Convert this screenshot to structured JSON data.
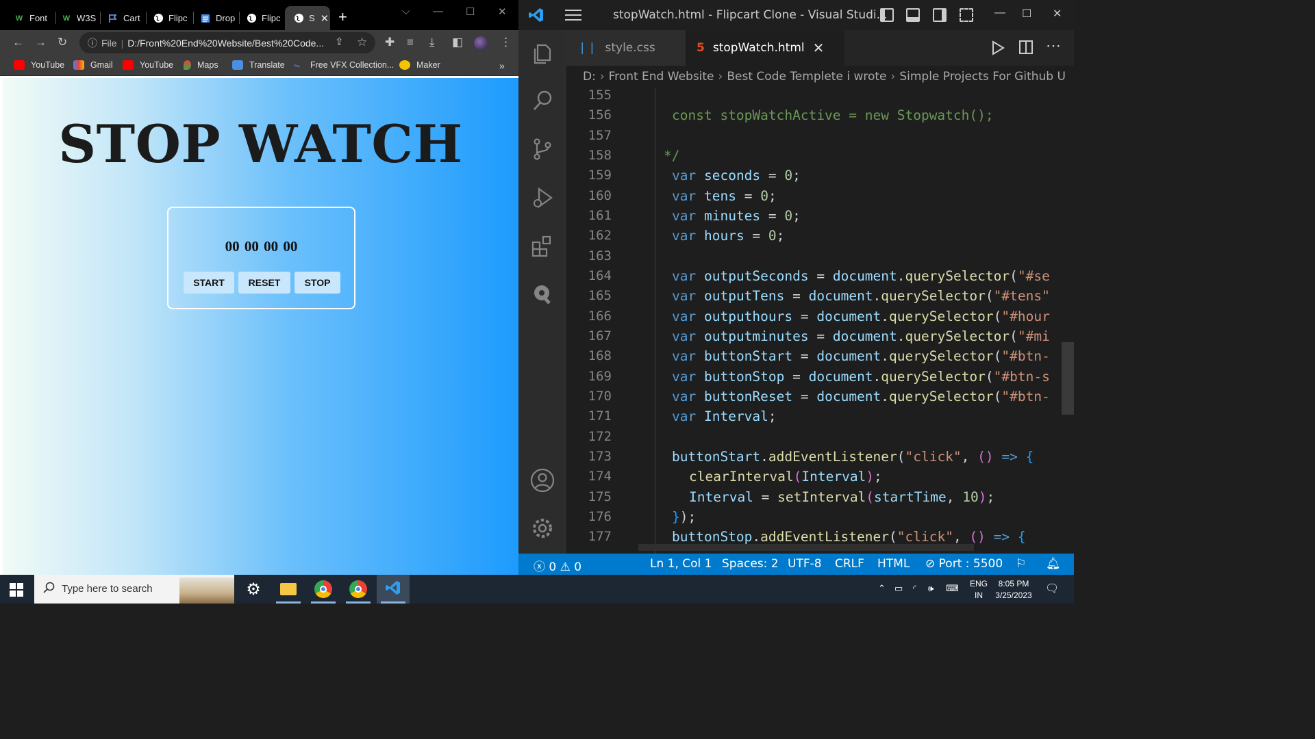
{
  "chrome": {
    "tabs": [
      {
        "label": "Font",
        "icon": "w-icon"
      },
      {
        "label": "W3S",
        "icon": "w-icon"
      },
      {
        "label": "Cart",
        "icon": "flag-icon"
      },
      {
        "label": "Flipc",
        "icon": "globe-icon"
      },
      {
        "label": "Drop",
        "icon": "doc-icon"
      },
      {
        "label": "Flipc",
        "icon": "globe-icon"
      },
      {
        "label": "S",
        "icon": "globe-icon",
        "active": true
      }
    ],
    "new_tab": "+",
    "url_prefix": "File",
    "url": "D:/Front%20End%20Website/Best%20Code...",
    "bookmarks": [
      "YouTube",
      "Gmail",
      "YouTube",
      "Maps",
      "Translate",
      "Free VFX Collection...",
      "Maker"
    ],
    "more_bookmarks": "»"
  },
  "page": {
    "title": "STOP WATCH",
    "time": "00  00  00  00",
    "buttons": {
      "start": "START",
      "reset": "RESET",
      "stop": "STOP"
    }
  },
  "vscode": {
    "title": "stopWatch.html - Flipcart Clone - Visual Studi...",
    "tabs": [
      {
        "label": "style.css",
        "icon": "css-icon"
      },
      {
        "label": "stopWatch.html",
        "icon": "html-icon",
        "active": true
      }
    ],
    "breadcrumb": [
      "D:",
      "Front End Website",
      "Best Code Templete i wrote",
      "Simple Projects For Github U"
    ],
    "line_numbers": [
      "155",
      "156",
      "157",
      "158",
      "159",
      "160",
      "161",
      "162",
      "163",
      "164",
      "165",
      "166",
      "167",
      "168",
      "169",
      "170",
      "171",
      "172",
      "173",
      "174",
      "175",
      "176",
      "177"
    ],
    "status": {
      "errors": "0",
      "warnings": "0",
      "position": "Ln 1, Col 1",
      "spaces": "Spaces: 2",
      "encoding": "UTF-8",
      "eol": "CRLF",
      "language": "HTML",
      "port": "Port : 5500"
    }
  },
  "taskbar": {
    "search_placeholder": "Type here to search",
    "lang": "ENG",
    "region": "IN",
    "time": "8:05 PM",
    "date": "3/25/2023"
  }
}
